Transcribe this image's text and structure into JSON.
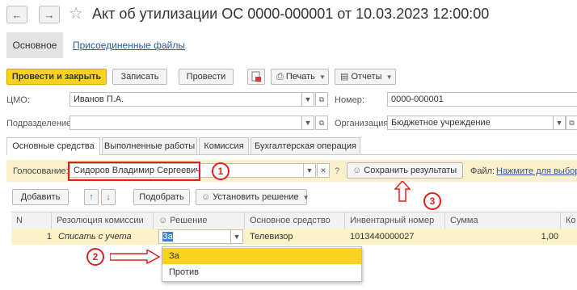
{
  "header": {
    "back_icon": "arrow-left-icon",
    "forward_icon": "arrow-right-icon",
    "favorite_icon": "star-icon",
    "title": "Акт об утилизации ОС 0000-000001 от 10.03.2023 12:00:00"
  },
  "top_tabs": {
    "main": "Основное",
    "attached": "Присоединенные файлы"
  },
  "toolbar": {
    "post_close": "Провести и закрыть",
    "save": "Записать",
    "post": "Провести",
    "print": "Печать",
    "reports": "Отчеты"
  },
  "fields": {
    "cmo_label": "ЦМО:",
    "cmo_value": "Иванов П.А.",
    "number_label": "Номер:",
    "number_value": "0000-000001",
    "dept_label": "Подразделение:",
    "dept_value": "",
    "org_label": "Организация:",
    "org_value": "Бюджетное учреждение"
  },
  "sub_tabs": [
    "Основные средства",
    "Выполненные работы",
    "Комиссия",
    "Бухгалтерская операция"
  ],
  "voting": {
    "label": "Голосование:",
    "value": "Сидоров Владимир Сергеевич",
    "help": "?",
    "save_results": "Сохранить результаты",
    "file_label": "Файл:",
    "file_link": "Нажмите для выбора"
  },
  "table_toolbar": {
    "add": "Добавить",
    "pick": "Подобрать",
    "set_decision": "Установить решение"
  },
  "table": {
    "headers": [
      "N",
      "Резолюция комиссии",
      "Решение",
      "Основное средство",
      "Инвентарный номер",
      "Сумма",
      "Ко"
    ],
    "row": {
      "n": "1",
      "resolution": "Списать с учета",
      "decision": "За",
      "asset": "Телевизор",
      "inventory": "1013440000027",
      "sum": "1,00"
    }
  },
  "dropdown_options": [
    "За",
    "Против"
  ],
  "annotations": [
    "1",
    "2",
    "3"
  ],
  "colors": {
    "accent_yellow": "#f9d21e",
    "highlight_row": "#fdf1c7",
    "annotation_red": "#e02020",
    "link_blue": "#2c5aa0"
  }
}
